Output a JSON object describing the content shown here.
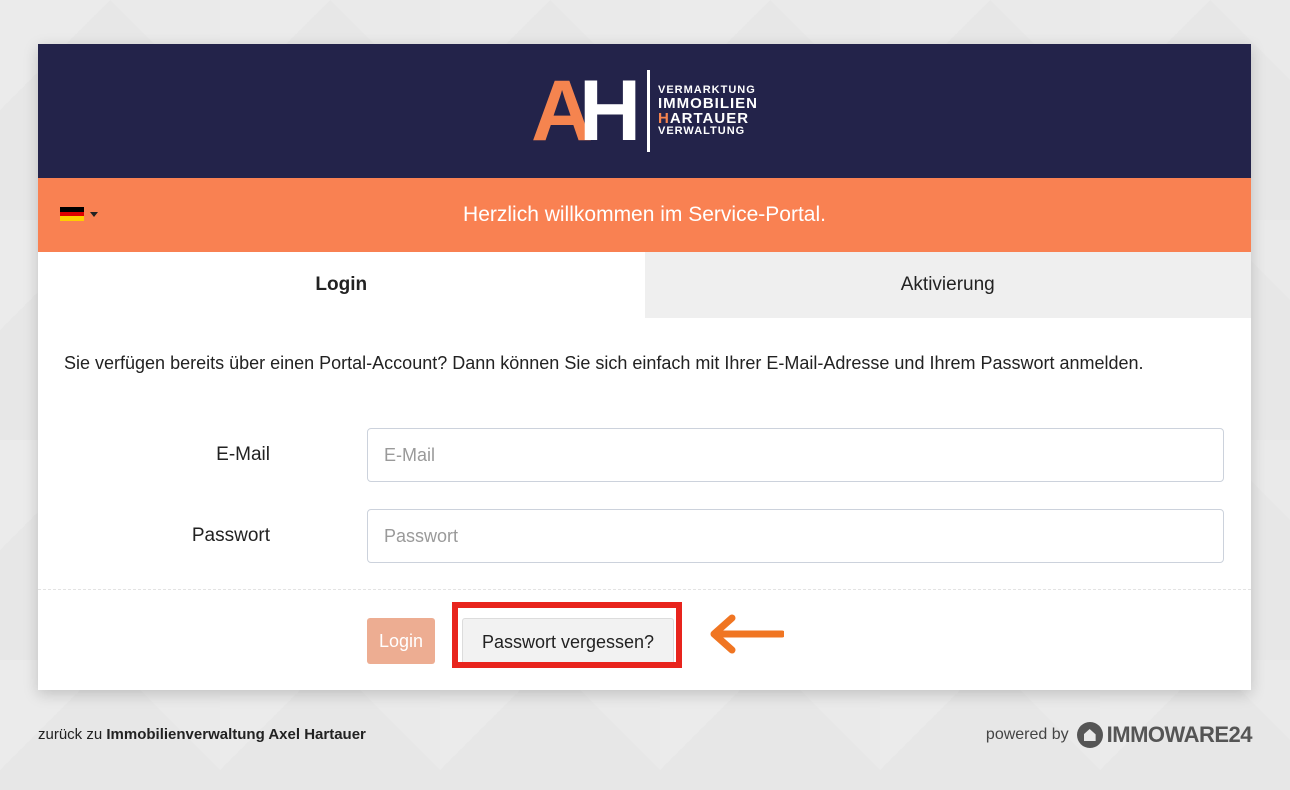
{
  "brand": {
    "logo_line1": "VERMARKTUNG",
    "logo_line2": "IMMOBILIEN",
    "logo_line3_h": "H",
    "logo_line3_rest": "ARTAUER",
    "logo_line4": "VERWALTUNG",
    "logo_letter_a": "A",
    "logo_letter_h": "H",
    "colors": {
      "navy": "#23234a",
      "orange": "#f98152",
      "highlight": "#e8241d"
    }
  },
  "welcome": {
    "text": "Herzlich willkommen im Service-Portal.",
    "language_icon": "german-flag-icon"
  },
  "tabs": [
    {
      "label": "Login",
      "active": true
    },
    {
      "label": "Aktivierung",
      "active": false
    }
  ],
  "intro": "Sie verfügen bereits über einen Portal-Account? Dann können Sie sich einfach mit Ihrer E-Mail-Adresse und Ihrem Passwort anmelden.",
  "form": {
    "email_label": "E-Mail",
    "email_placeholder": "E-Mail",
    "password_label": "Passwort",
    "password_placeholder": "Passwort",
    "login_button": "Login",
    "forgot_button": "Passwort vergessen?"
  },
  "footer": {
    "back_prefix": "zurück zu",
    "back_link": "Immobilienverwaltung Axel Hartauer",
    "powered_by": "powered by",
    "vendor": "IMMOWARE24"
  }
}
